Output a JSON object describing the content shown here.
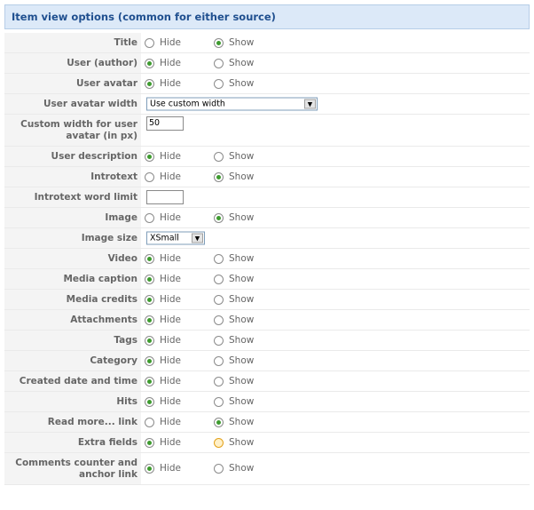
{
  "panel": {
    "title": "Item view options (common for either source)"
  },
  "options": {
    "hide": "Hide",
    "show": "Show"
  },
  "rows": {
    "title": {
      "label": "Title",
      "selected": "show"
    },
    "user_author": {
      "label": "User (author)",
      "selected": "hide"
    },
    "user_avatar": {
      "label": "User avatar",
      "selected": "hide"
    },
    "user_avatar_width": {
      "label": "User avatar width",
      "value": "Use custom width"
    },
    "custom_width": {
      "label": "Custom width for user avatar (in px)",
      "value": "50"
    },
    "user_description": {
      "label": "User description",
      "selected": "hide"
    },
    "introtext": {
      "label": "Introtext",
      "selected": "show"
    },
    "introtext_word_limit": {
      "label": "Introtext word limit",
      "value": ""
    },
    "image": {
      "label": "Image",
      "selected": "show"
    },
    "image_size": {
      "label": "Image size",
      "value": "XSmall"
    },
    "video": {
      "label": "Video",
      "selected": "hide"
    },
    "media_caption": {
      "label": "Media caption",
      "selected": "hide"
    },
    "media_credits": {
      "label": "Media credits",
      "selected": "hide"
    },
    "attachments": {
      "label": "Attachments",
      "selected": "hide"
    },
    "tags": {
      "label": "Tags",
      "selected": "hide"
    },
    "category": {
      "label": "Category",
      "selected": "hide"
    },
    "created_date": {
      "label": "Created date and time",
      "selected": "hide"
    },
    "hits": {
      "label": "Hits",
      "selected": "hide"
    },
    "read_more": {
      "label": "Read more... link",
      "selected": "show"
    },
    "extra_fields": {
      "label": "Extra fields",
      "selected": "hide"
    },
    "comments_counter": {
      "label": "Comments counter and anchor link",
      "selected": "hide"
    }
  }
}
